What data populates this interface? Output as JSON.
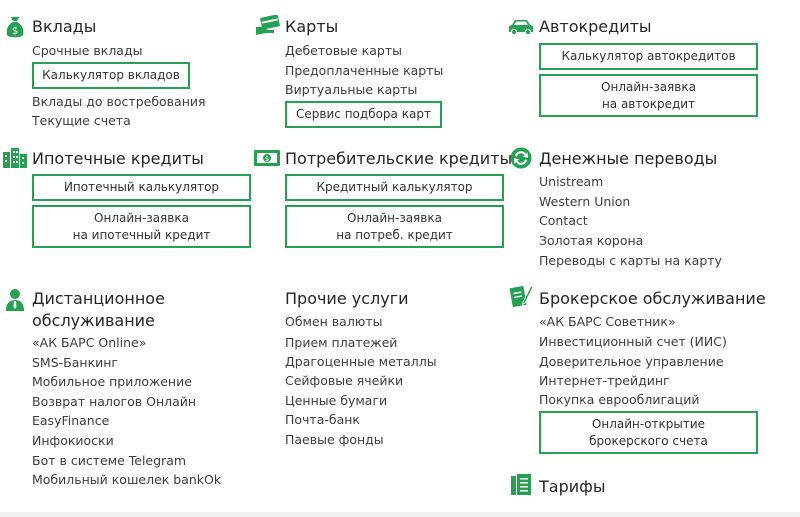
{
  "colors": {
    "accent": "#25a152",
    "text": "#3d3d3d",
    "title": "#262626"
  },
  "deposits": {
    "icon": "money-bag-icon",
    "title": "Вклады",
    "links": [
      "Срочные вклады"
    ],
    "calc_button": "Калькулятор вкладов",
    "links2": [
      "Вклады до востребования",
      "Текущие счета"
    ]
  },
  "cards": {
    "icon": "card-hand-icon",
    "title": "Карты",
    "links": [
      "Дебетовые карты",
      "Предоплаченные карты",
      "Виртуальные карты"
    ],
    "button": "Сервис подбора карт"
  },
  "autoloans": {
    "icon": "car-icon",
    "title": "Автокредиты",
    "calc_button": "Калькулятор автокредитов",
    "apply_button": "Онлайн-заявка\nна автокредит"
  },
  "mortgage": {
    "icon": "buildings-icon",
    "title": "Ипотечные кредиты",
    "calc_button": "Ипотечный калькулятор",
    "apply_button": "Онлайн-заявка\nна ипотечный кредит"
  },
  "consumer": {
    "icon": "cash-icon",
    "title": "Потребительские кредиты",
    "calc_button": "Кредитный калькулятор",
    "apply_button": "Онлайн-заявка\nна потреб. кредит"
  },
  "transfers": {
    "icon": "exchange-icon",
    "title": "Денежные переводы",
    "links": [
      "Unistream",
      "Western Union",
      "Contact",
      "Золотая корона",
      "Переводы с карты на карту"
    ]
  },
  "remote": {
    "icon": "person-icon",
    "title_line1": "Дистанционное",
    "title_line2": "обслуживание",
    "links": [
      "«АК БАРС Online»",
      "SMS-Банкинг",
      "Мобильное приложение",
      "Возврат налогов Онлайн",
      "EasyFinance",
      "Инфокиоски",
      "Бот в системе Telegram",
      "Мобильный кошелек bankOk"
    ]
  },
  "other": {
    "title": "Прочие услуги",
    "links": [
      "Обмен валюты",
      "Прием платежей",
      "Драгоценные металлы",
      "Сейфовые ячейки",
      "Ценные бумаги",
      "Почта-банк",
      "Паевые фонды"
    ]
  },
  "broker": {
    "icon": "document-pen-icon",
    "title": "Брокерское обслуживание",
    "links": [
      "«АК БАРС Советник»",
      "Инвестиционный счет (ИИС)",
      "Доверительное управление",
      "Интернет-трейдинг",
      "Покупка еврооблигаций"
    ],
    "apply_button": "Онлайн-открытие\nброкерского счета"
  },
  "tariffs": {
    "icon": "book-icon",
    "title": "Тарифы"
  }
}
